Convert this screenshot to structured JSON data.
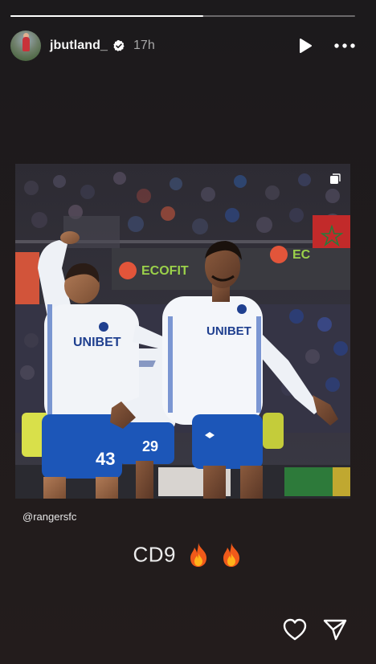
{
  "story": {
    "progress": 0.56,
    "user": {
      "username": "jbutland_",
      "verified": true,
      "time_ago": "17h"
    },
    "header_icons": [
      "play-icon",
      "more-options-icon"
    ],
    "photo": {
      "shirt_sponsor": "UNIBET",
      "shirt_numbers": [
        "43",
        "29"
      ],
      "ad_boards": [
        "ECOFIT",
        "EC"
      ]
    },
    "mention": "@rangersfc",
    "caption": {
      "text": "CD9",
      "emojis": [
        "fire",
        "fire"
      ]
    },
    "footer_icons": [
      "heart-icon",
      "send-icon"
    ]
  }
}
